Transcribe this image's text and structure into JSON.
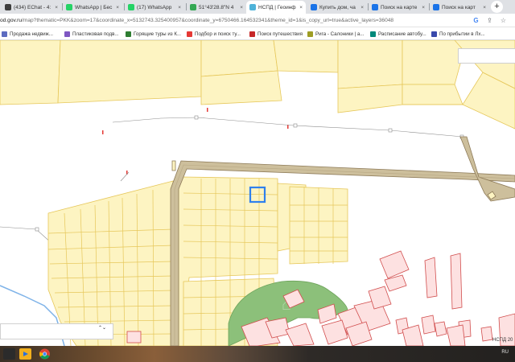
{
  "browser": {
    "tabs": [
      {
        "title": "(434) EChat - 4:",
        "favicon_color": "#3d3d3d",
        "active": false
      },
      {
        "title": "WhatsApp | Бес",
        "favicon_color": "#25d366",
        "active": false
      },
      {
        "title": "(17) WhatsApp",
        "favicon_color": "#25d366",
        "active": false
      },
      {
        "title": "51°43'28.8\"N 4",
        "favicon_color": "#34a853",
        "active": false
      },
      {
        "title": "НСПД | Геоинф",
        "favicon_color": "#4fb3d9",
        "active": true
      },
      {
        "title": "Купить дом, ча",
        "favicon_color": "#1a73e8",
        "active": false
      },
      {
        "title": "Поиск на карте",
        "favicon_color": "#1a73e8",
        "active": false
      },
      {
        "title": "Поиск на карт",
        "favicon_color": "#1a73e8",
        "active": false
      }
    ],
    "tab_close_glyph": "×",
    "new_tab_glyph": "+",
    "url_prefix": "od.gov.ru",
    "url_path": "/map?thematic=PKK&zoom=17&coordinate_x=5132743.325400957&coordinate_y=6750466.164532341&theme_id=1&is_copy_url=true&active_layers=36048",
    "address_icons": [
      "google-icon",
      "share-icon",
      "star-icon"
    ],
    "address_icon_glyphs": [
      "G",
      "⇪",
      "☆"
    ]
  },
  "bookmarks": [
    {
      "label": "Продажа недвиж...",
      "icon_color": "#5c6bc0"
    },
    {
      "label": "Пластиковая подв...",
      "icon_color": "#7e57c2"
    },
    {
      "label": "Горящие туры из К...",
      "icon_color": "#2e7d32"
    },
    {
      "label": "Подбор и поиск ту...",
      "icon_color": "#e53935"
    },
    {
      "label": "Поиск путешествия",
      "icon_color": "#c62828"
    },
    {
      "label": "Рига - Салоники | а...",
      "icon_color": "#9e9d24"
    },
    {
      "label": "Расписание автобу...",
      "icon_color": "#00897b"
    },
    {
      "label": "По прибытии в Лх...",
      "icon_color": "#3949ab"
    }
  ],
  "map": {
    "scale_label": "НСПД 20",
    "layer_select_arrows": "⌃⌄",
    "colors": {
      "parcel_fill": "#fdf4c2",
      "parcel_stroke": "#e6c75a",
      "road_fill": "#cdbf9c",
      "road_stroke": "#8d7a58",
      "green_area": "#8cc07a",
      "building_fill": "#fde1e1",
      "building_stroke": "#d14d4d",
      "selected_parcel": "#2f80ed",
      "water_line": "#7fb3e8"
    }
  },
  "taskbar": {
    "icons": [
      "windows-icon",
      "media-icon",
      "chrome-icon"
    ],
    "tray_language": "RU"
  }
}
